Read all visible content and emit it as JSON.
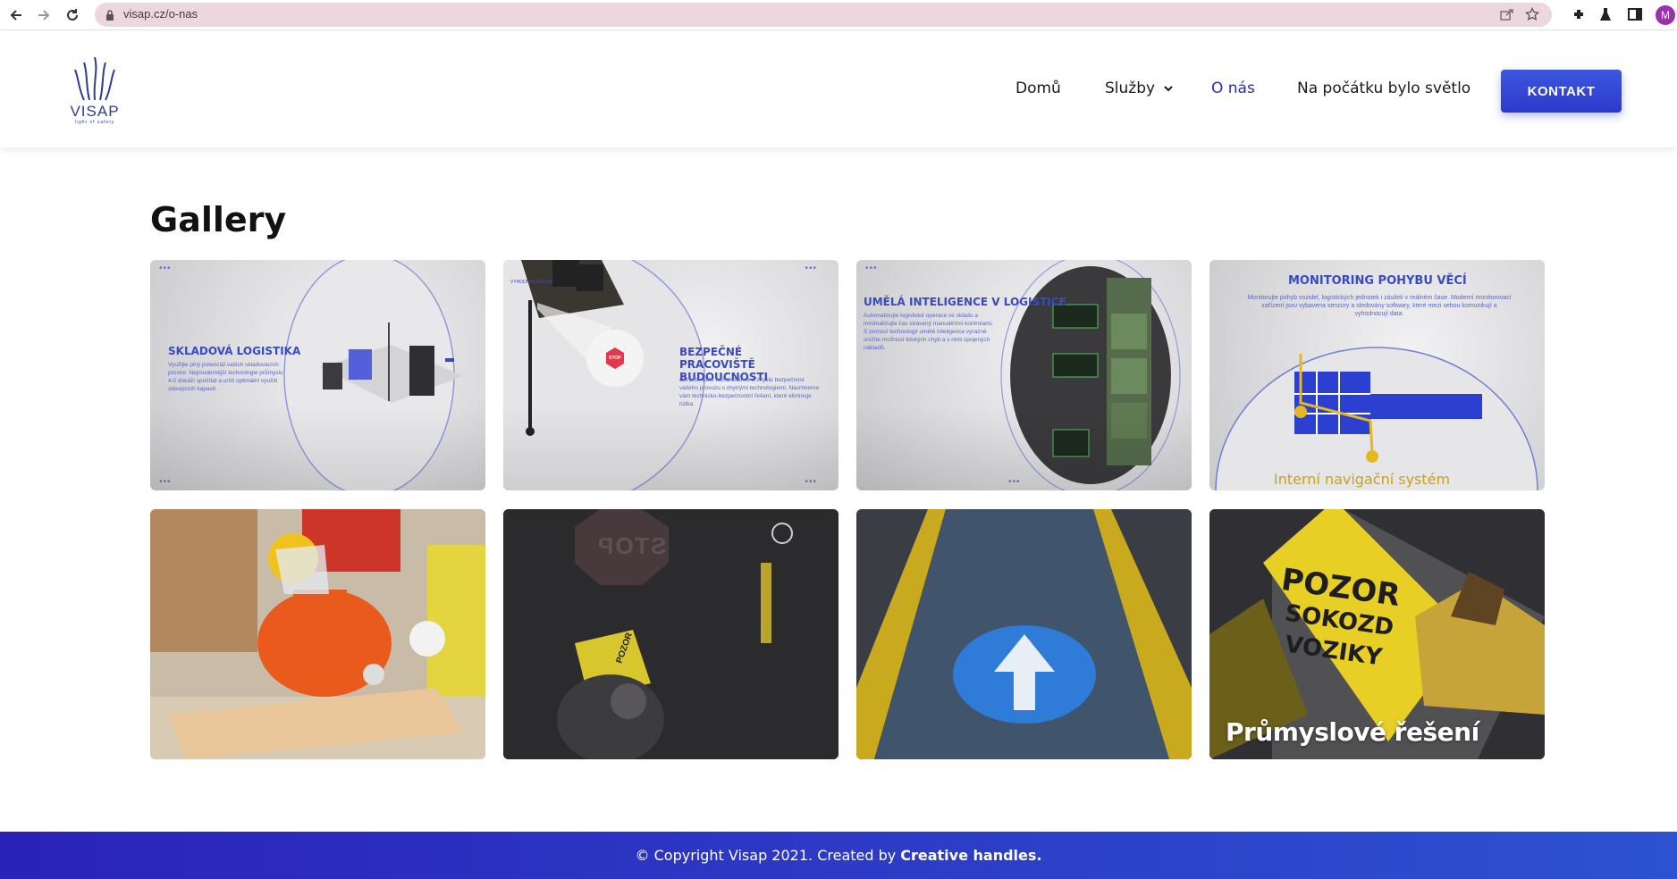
{
  "browser": {
    "url": "visap.cz/o-nas",
    "profile_initial": "M"
  },
  "site": {
    "logo_text": "VISAP",
    "logo_tagline": "light of safety",
    "nav": [
      {
        "label": "Domů"
      },
      {
        "label": "Služby"
      },
      {
        "label": "O nás",
        "active": true
      },
      {
        "label": "Na počátku bylo světlo"
      }
    ],
    "cta_label": "KONTAKT",
    "brand_color": "#2b39c9"
  },
  "gallery": {
    "title": "Gallery",
    "tiles": [
      {
        "heading": "SKLADOVÁ LOGISTIKA",
        "text": "Využijte plný potenciál vašich skladovacích prostor. Nejmodernější technologie průmyslu 4.0 dokáží spočítat a určit optimální využití stávajících kapacit."
      },
      {
        "heading": "BEZPEČNÉ PRACOVIŠTĚ BUDOUCNOSTI",
        "text": "Chraňte vaše zaměstnance a zvyšte bezpečnost vašeho provozu s chytrými technologiemi. Navrhneme vám technicko-bezpečnostní řešení, které eliminuje rizika.",
        "sign_label": "VYHODNOCENÍ DAT",
        "stop_text": "STOP"
      },
      {
        "heading": "UMĚLÁ INTELIGENCE V LOGISTICE",
        "text": "Automatizujte logistické operace ve skladu a minimalizujte čas strávený manuálními kontrolami. S pomocí technologií umělé inteligence vyrazně snížíte možnost lidských chyb a s nimi spojených nákladů."
      },
      {
        "heading": "MONITORING POHYBU VĚCÍ",
        "text": "Monitorujte pohyb vozidel, logistických jednotek i zásilek v reálném čase. Moderní monitorovací zařízení jsou vybavena senzory a sledovány softwary, které mezi sebou komunikují a vyhodnocují data.",
        "map_label": "Sklad",
        "caption": "Interní navigační systém"
      },
      {
        "alt": "worker-grinding"
      },
      {
        "alt": "stop-projection",
        "sign_text": "STOP",
        "board_text": "POZOR"
      },
      {
        "alt": "arrow-projection"
      },
      {
        "alt": "warning-sign",
        "board_text": "POZOR",
        "board_lines": [
          "SOKOZD",
          "VOZIKY"
        ],
        "caption": "Průmyslové řešení"
      }
    ]
  },
  "footer": {
    "text": "© Copyright Visap 2021. Created by",
    "link": "Creative handles."
  }
}
